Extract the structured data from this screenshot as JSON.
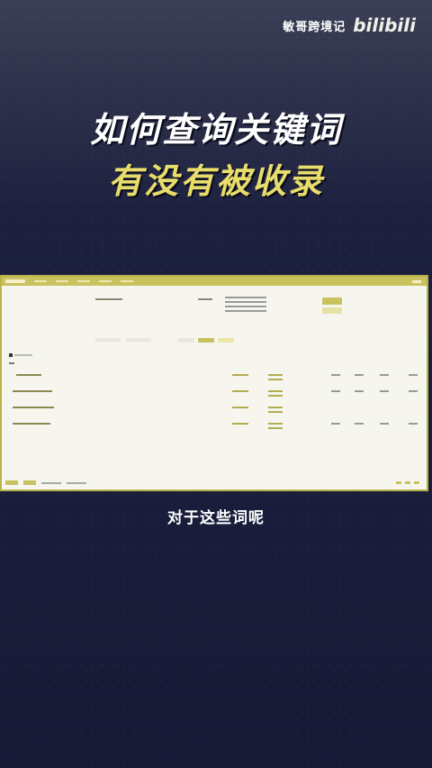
{
  "channel": {
    "name": "敏哥跨境记",
    "platform_logo": "bilibili"
  },
  "headline": {
    "line1": "如何查询关键词",
    "line2": "有没有被收录"
  },
  "caption": "对于这些词呢",
  "colors": {
    "accent": "#e8dd6b",
    "background": "#1d2140",
    "screenshot_accent": "#c9c25f"
  }
}
